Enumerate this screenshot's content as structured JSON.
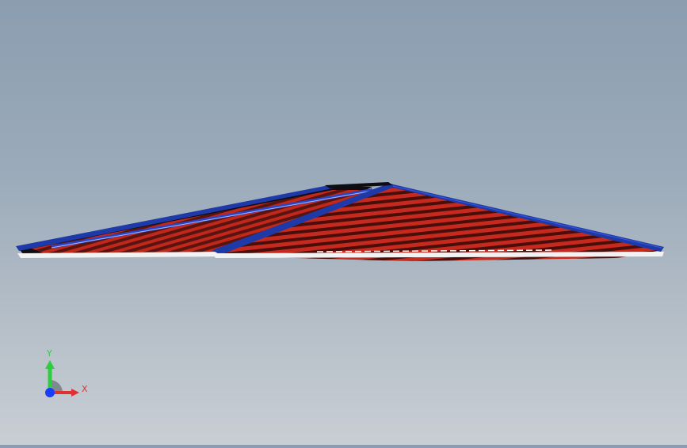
{
  "viewport": {
    "background_top": "#8b9db0",
    "background_bottom": "#c8ced4"
  },
  "model": {
    "description_icon": "hip-roof-frame-model",
    "colors": {
      "rafters": "#c0281c",
      "ridge_beams": "#1e3aa8",
      "dark_edge": "#0d0d12",
      "base_plate": "#f2f2f2"
    }
  },
  "triad": {
    "x_label": "X",
    "y_label": "Y",
    "colors": {
      "x": "#e03030",
      "y": "#2ecc40",
      "z": "#1a3cff"
    }
  }
}
